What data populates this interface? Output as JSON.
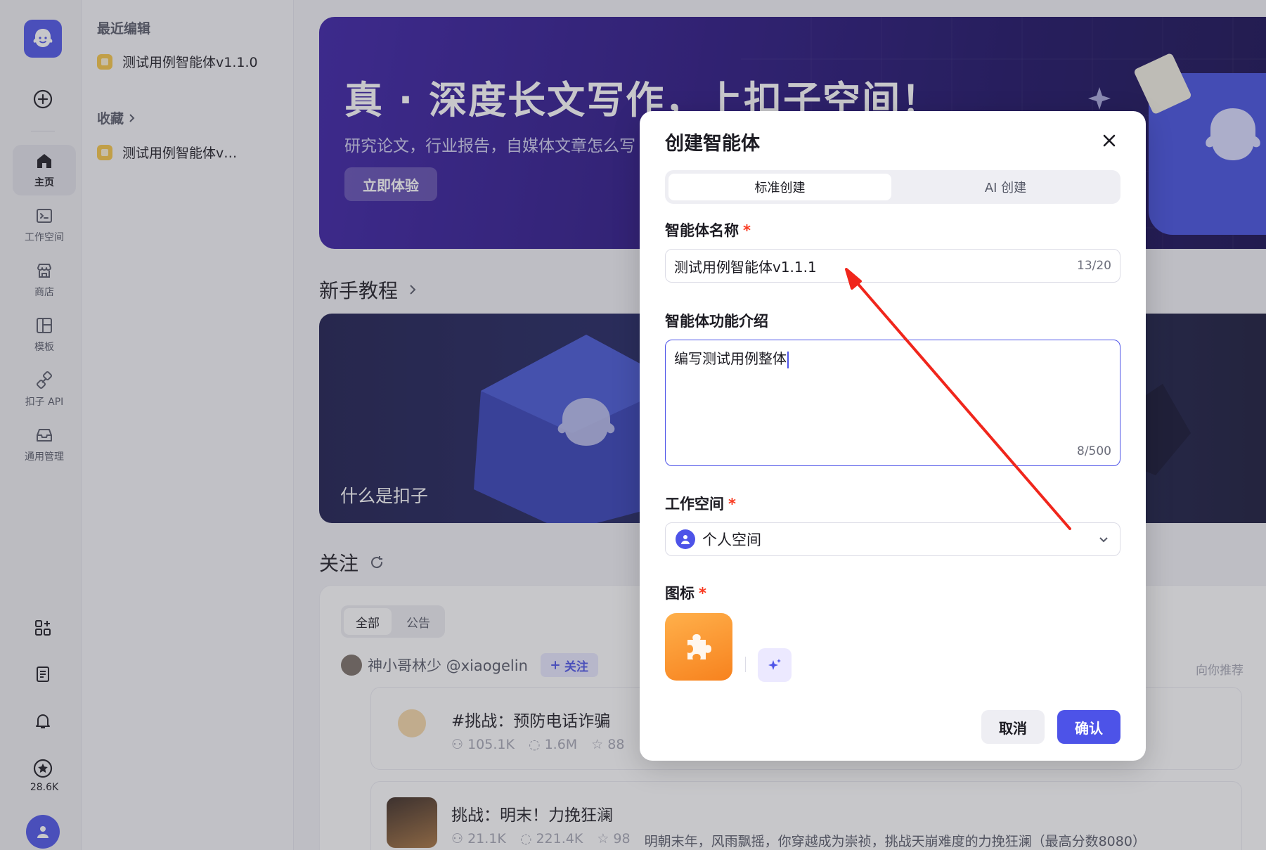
{
  "rail": {
    "items": [
      {
        "label": "主页",
        "icon": "home-icon",
        "active": true
      },
      {
        "label": "工作空间",
        "icon": "terminal-folder-icon"
      },
      {
        "label": "商店",
        "icon": "store-icon"
      },
      {
        "label": "模板",
        "icon": "template-icon"
      },
      {
        "label": "扣子 API",
        "icon": "api-link-icon"
      },
      {
        "label": "通用管理",
        "icon": "inbox-icon"
      }
    ],
    "bottom_icons": [
      "apps-grid-icon",
      "document-icon",
      "bell-icon"
    ],
    "points_count": "28.6K"
  },
  "sidebar": {
    "recent_heading": "最近编辑",
    "recent_items": [
      {
        "label": "测试用例智能体v1.1.0"
      }
    ],
    "favorites_heading": "收藏",
    "favorites_items": [
      {
        "label": "测试用例智能体v…"
      }
    ]
  },
  "main": {
    "banner": {
      "title": "真 · 深度长文写作，上扣子空间！",
      "subtitle": "研究论文，行业报告，自媒体文章怎么写",
      "button": "立即体验"
    },
    "tutorial_heading": "新手教程",
    "tutorial_card_label": "什么是扣子",
    "follow_heading": "关注",
    "follow_tabs": [
      "全部",
      "公告"
    ],
    "author": {
      "name": "神小哥林少 @xiaogelin",
      "follow_label": "关注"
    },
    "recommend_label": "向你推荐",
    "feed": [
      {
        "title": "#挑战：预防电话诈骗",
        "users": "105.1K",
        "comments": "1.6M",
        "stars": "88",
        "desc": ""
      },
      {
        "title": "挑战：明末！力挽狂澜",
        "users": "21.1K",
        "comments": "221.4K",
        "stars": "98",
        "desc": "明朝末年，风雨飘摇，你穿越成为崇祯，挑战天崩难度的力挽狂澜（最高分数8080）"
      }
    ]
  },
  "modal": {
    "title": "创建智能体",
    "tabs": [
      "标准创建",
      "AI 创建"
    ],
    "name_label": "智能体名称",
    "name_value": "测试用例智能体v1.1.1",
    "name_count": "13/20",
    "desc_label": "智能体功能介绍",
    "desc_value": "编写测试用例整体",
    "desc_count": "8/500",
    "workspace_label": "工作空间",
    "workspace_value": "个人空间",
    "icon_label": "图标",
    "cancel": "取消",
    "confirm": "确认"
  },
  "colors": {
    "accent": "#4d53e8",
    "required": "#f93920",
    "annotation_arrow": "#f0261c",
    "icon_orange": "#f7821e"
  }
}
